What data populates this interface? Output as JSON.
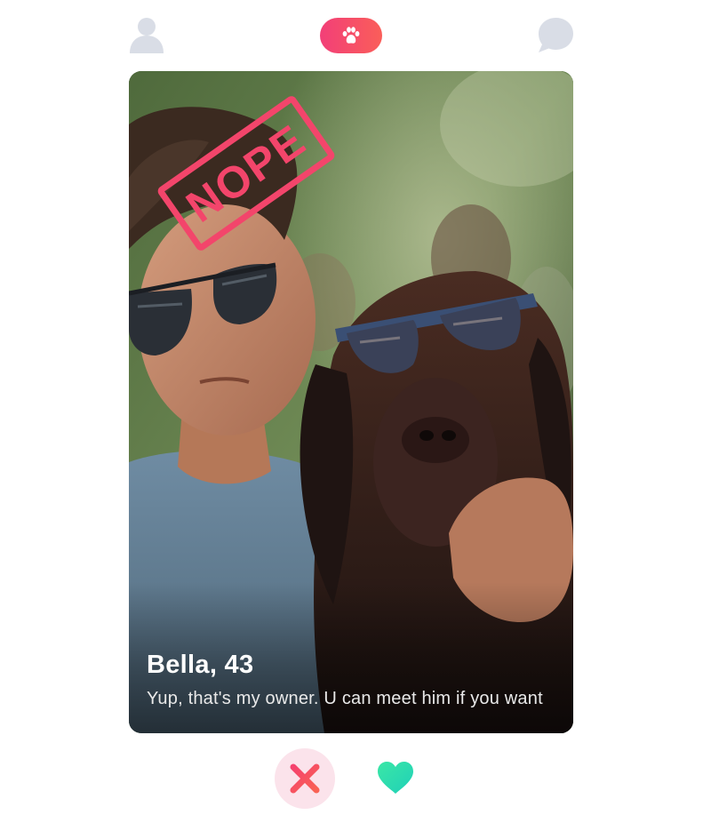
{
  "header": {
    "profile_icon": "person-icon",
    "center_icon": "paw-icon",
    "chat_icon": "chat-bubble-icon"
  },
  "card": {
    "name": "Bella, 43",
    "bio": "Yup, that's my owner. U can meet him if you want",
    "stamp": "NOPE"
  },
  "actions": {
    "dislike_icon": "close-icon",
    "like_icon": "heart-icon"
  },
  "colors": {
    "accent_pink": "#f23f78",
    "accent_orange": "#fa5e59",
    "nope_red": "#f3456b",
    "like_green": "#2ee0a8",
    "icon_gray": "#d9dde6",
    "dislike_bg": "#fbe3eb"
  }
}
